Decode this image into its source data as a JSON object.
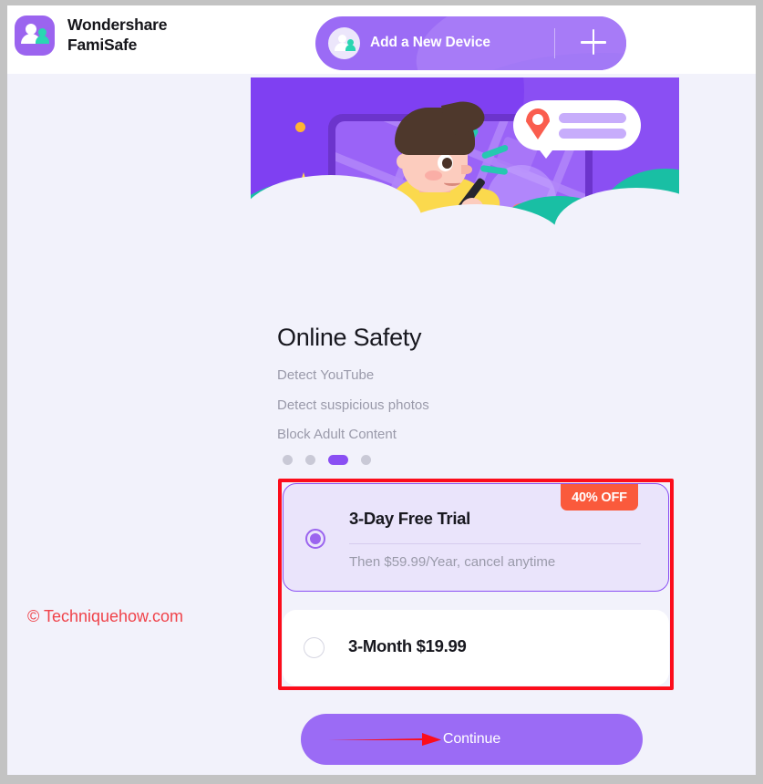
{
  "header": {
    "brand_line1": "Wondershare",
    "brand_line2": "FamiSafe",
    "app_icon": "family-logo-icon",
    "add_device": {
      "label": "Add a New Device",
      "avatar_icon": "family-avatar-icon",
      "plus_icon": "plus-icon"
    }
  },
  "hero": {
    "illustration": "boy-with-phone-map-location-illustration",
    "background_color": "#8a4ff3",
    "accent_teal": "#19bfa4",
    "accent_yellow": "#fbd94d",
    "pin_color": "#fa5d4e"
  },
  "content": {
    "headline": "Online Safety",
    "features": [
      "Detect YouTube",
      "Detect suspicious photos",
      "Block Adult Content"
    ],
    "pagination": {
      "total": 4,
      "active_index": 2,
      "active_color": "#8a4ff3",
      "inactive_color": "#c9c9d6"
    }
  },
  "plans": {
    "badge": "40% OFF",
    "badge_color": "#fa5a3c",
    "items": [
      {
        "title": "3-Day Free Trial",
        "subtitle": "Then $59.99/Year, cancel anytime",
        "selected": true
      },
      {
        "title": "3-Month $19.99",
        "subtitle": "",
        "selected": false
      }
    ]
  },
  "cta": {
    "label": "Continue",
    "color": "#9b6bf5"
  },
  "annotations": {
    "highlight_color": "#fc0d1b",
    "arrow": "red-arrow-pointing-to-continue",
    "watermark": "© Techniquehow.com"
  }
}
